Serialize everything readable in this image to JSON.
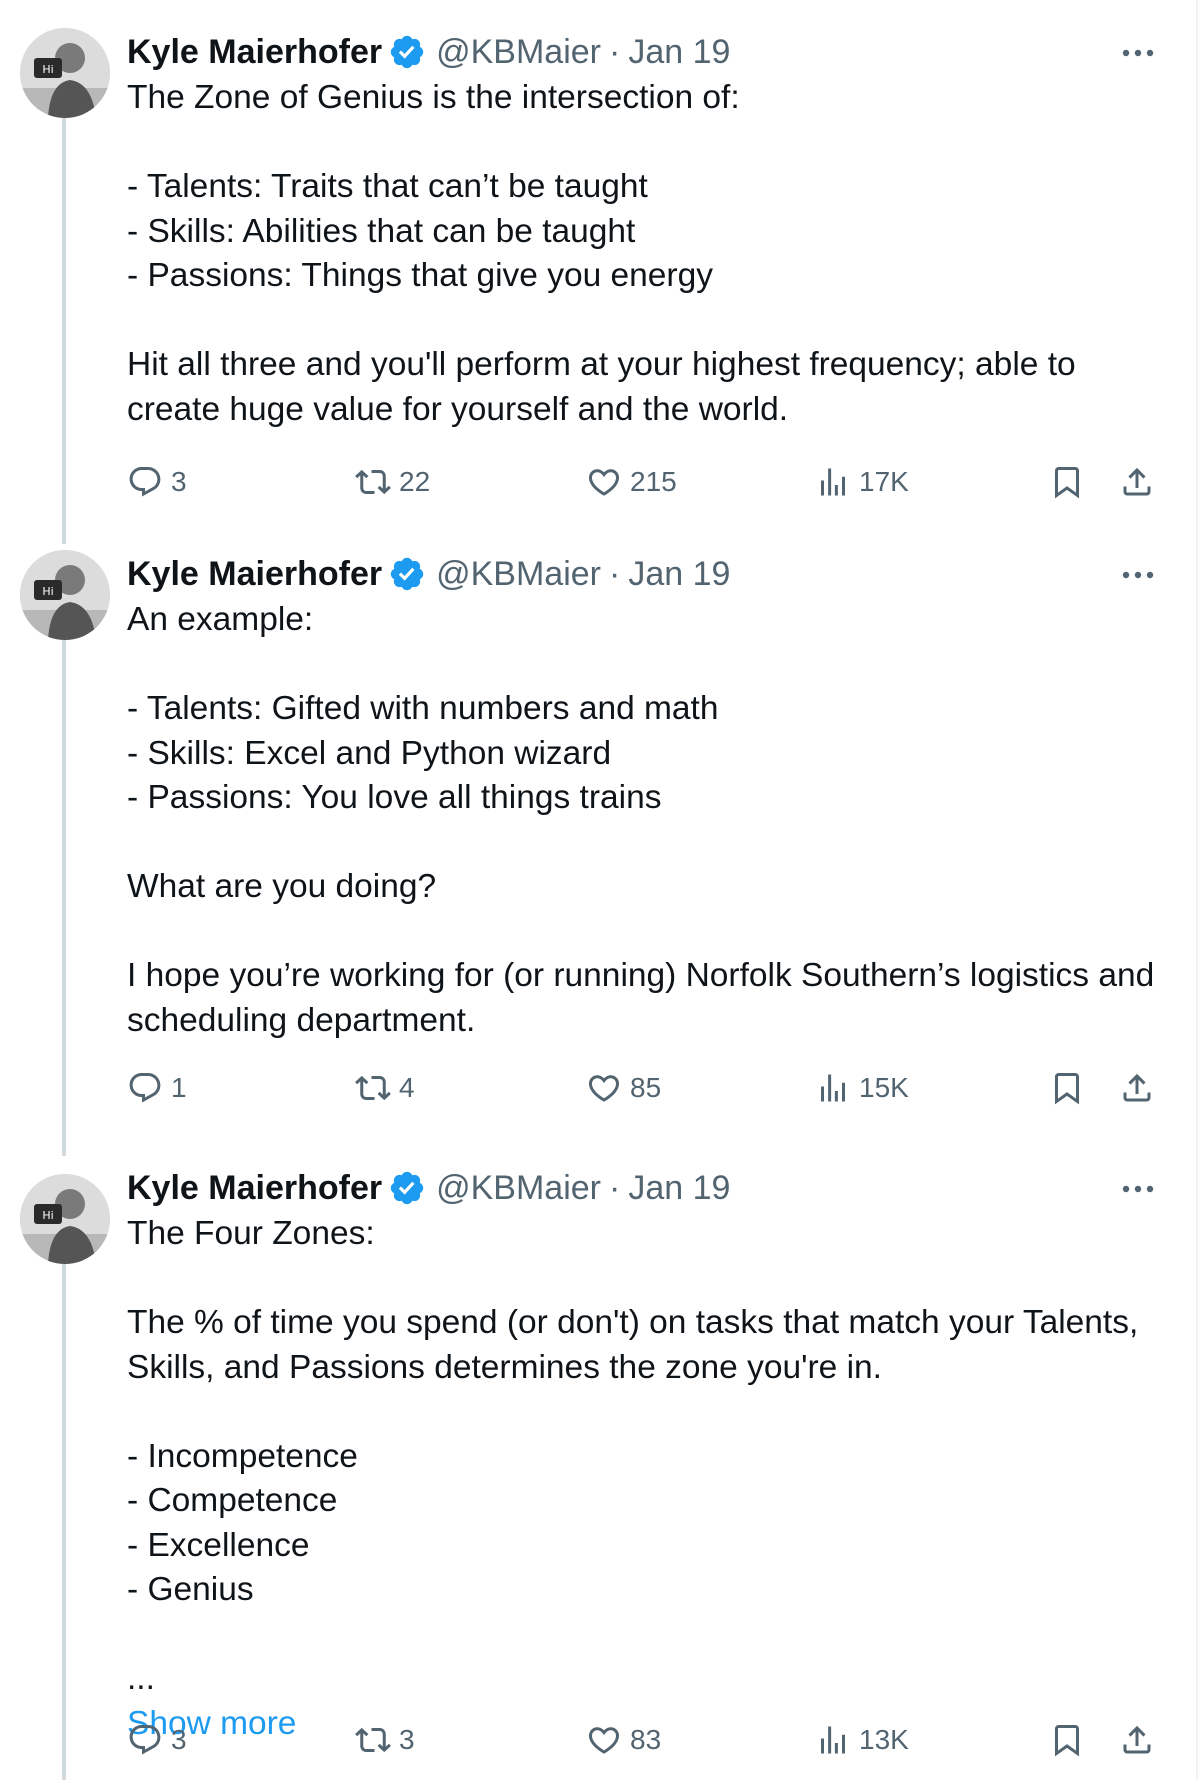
{
  "author": {
    "name": "Kyle Maierhofer",
    "handle": "@KBMaier",
    "separator": "·"
  },
  "colors": {
    "text": "#0f1419",
    "secondary": "#536471",
    "link": "#1d9bf0",
    "verified": "#1d9bf0",
    "thread_line": "#cfd9de"
  },
  "icons": {
    "verified": "verified-badge-icon",
    "more": "more-horizontal-icon",
    "reply": "reply-icon",
    "retweet": "retweet-icon",
    "like": "heart-icon",
    "views": "views-chart-icon",
    "bookmark": "bookmark-icon",
    "share": "share-icon"
  },
  "tweets": [
    {
      "date": "Jan 19",
      "text": "The Zone of Genius is the intersection of:\n\n- Talents: Traits that can’t be taught\n- Skills: Abilities that can be taught\n- Passions: Things that give you energy\n\nHit all three and you'll perform at your highest frequency; able to create huge value for yourself and the world.",
      "replies": "3",
      "retweets": "22",
      "likes": "215",
      "views": "17K"
    },
    {
      "date": "Jan 19",
      "text": "An example:\n\n- Talents: Gifted with numbers and math\n- Skills: Excel and Python wizard\n- Passions: You love all things trains\n\nWhat are you doing?\n\nI hope you’re working for (or running) Norfolk Southern’s logistics and scheduling department.",
      "replies": "1",
      "retweets": "4",
      "likes": "85",
      "views": "15K"
    },
    {
      "date": "Jan 19",
      "text": "The Four Zones:\n\nThe % of time you spend (or don't) on tasks that match your Talents, Skills, and Passions determines the zone you're in.\n\n- Incompetence\n- Competence\n- Excellence\n- Genius\n\n...",
      "show_more": "Show more",
      "replies": "3",
      "retweets": "3",
      "likes": "83",
      "views": "13K"
    }
  ]
}
